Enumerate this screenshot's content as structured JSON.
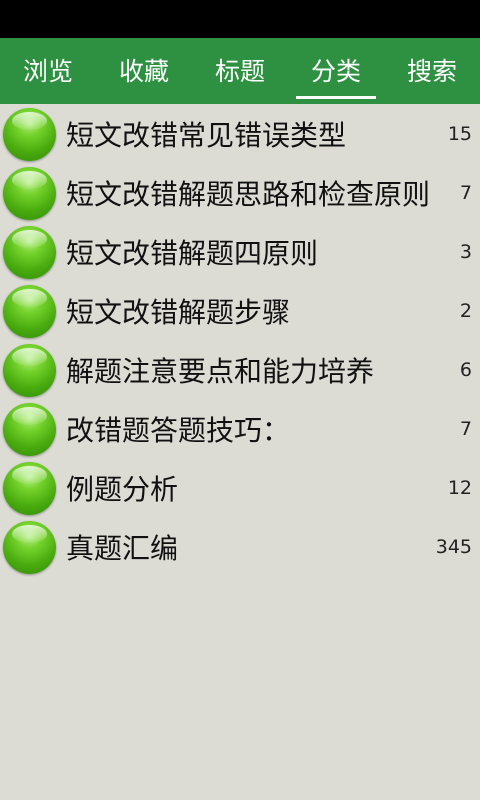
{
  "tabs": [
    {
      "label": "浏览",
      "active": false
    },
    {
      "label": "收藏",
      "active": false
    },
    {
      "label": "标题",
      "active": false
    },
    {
      "label": "分类",
      "active": true
    },
    {
      "label": "搜索",
      "active": false
    }
  ],
  "categories": [
    {
      "label": "短文改错常见错误类型",
      "count": "15"
    },
    {
      "label": "短文改错解题思路和检查原则",
      "count": "7"
    },
    {
      "label": "短文改错解题四原则",
      "count": "3"
    },
    {
      "label": "短文改错解题步骤",
      "count": "2"
    },
    {
      "label": "解题注意要点和能力培养",
      "count": "6"
    },
    {
      "label": "改错题答题技巧：",
      "count": "7"
    },
    {
      "label": "例题分析",
      "count": "12"
    },
    {
      "label": "真题汇编",
      "count": "345"
    }
  ],
  "colors": {
    "tab_bar": "#2e9141",
    "background": "#dcdcd5",
    "status_bar": "#000000"
  }
}
